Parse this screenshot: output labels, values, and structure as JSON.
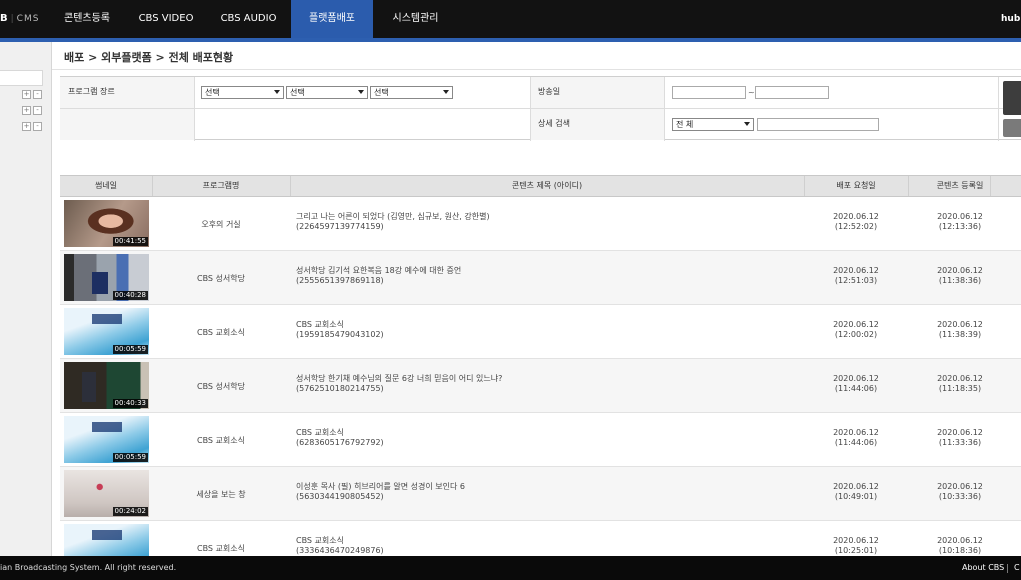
{
  "app": {
    "logo_letter": "B",
    "logo_text": "CMS",
    "user": "hubm"
  },
  "nav": [
    {
      "label": "콘텐츠등록"
    },
    {
      "label": "CBS VIDEO"
    },
    {
      "label": "CBS AUDIO"
    },
    {
      "label": "플랫폼배포"
    },
    {
      "label": "시스템관리"
    }
  ],
  "nav_active": "플랫폼배포",
  "breadcrumb": "배포 > 외부플랫폼 > 전체 배포현황",
  "search": {
    "genre_label": "프로그램 장르",
    "genre_selects": [
      "선택",
      "선택",
      "선택"
    ],
    "airdate_label": "방송일",
    "airdate_sep": "~",
    "detail_label": "상세 검색",
    "detail_select": "전 체"
  },
  "table": {
    "headers": [
      "썸네일",
      "프로그램명",
      "콘텐츠 제목 (아이디)",
      "배포 요청일",
      "콘텐츠 등록일"
    ],
    "rows": [
      {
        "thumb": "portrait",
        "duration": "00:41:55",
        "program": "오후의 거실",
        "title": "그리고 나는 어른이 되었다 (김영만, 심규보, 원산, 강한별)",
        "id": "(2264597139774159)",
        "req_date": "2020.06.12",
        "req_time": "(12:52:02)",
        "reg_date": "2020.06.12",
        "reg_time": "(12:13:36)"
      },
      {
        "thumb": "podium",
        "duration": "00:40:28",
        "program": "CBS 성서학당",
        "title": "성서학당 김기석 요한복음 18강 예수에 대한 증언",
        "id": "(2555651397869118)",
        "req_date": "2020.06.12",
        "req_time": "(12:51:03)",
        "reg_date": "2020.06.12",
        "reg_time": "(11:38:36)"
      },
      {
        "thumb": "news",
        "duration": "00:05:59",
        "program": "CBS 교회소식",
        "title": "CBS 교회소식",
        "id": "(1959185479043102)",
        "req_date": "2020.06.12",
        "req_time": "(12:00:02)",
        "reg_date": "2020.06.12",
        "reg_time": "(11:38:39)"
      },
      {
        "thumb": "board",
        "duration": "00:40:33",
        "program": "CBS 성서학당",
        "title": "성서학당 한기채 예수님의 질문 6강 너희 믿음이 어디 있느냐?",
        "id": "(5762510180214755)",
        "req_date": "2020.06.12",
        "req_time": "(11:44:06)",
        "reg_date": "2020.06.12",
        "reg_time": "(11:18:35)"
      },
      {
        "thumb": "news",
        "duration": "00:05:59",
        "program": "CBS 교회소식",
        "title": "CBS 교회소식",
        "id": "(6283605176792792)",
        "req_date": "2020.06.12",
        "req_time": "(11:44:06)",
        "reg_date": "2020.06.12",
        "reg_time": "(11:33:36)"
      },
      {
        "thumb": "room",
        "duration": "00:24:02",
        "program": "세상을 보는 창",
        "title": "이성훈 목사 (필) 히브리어를 알면 성경이 보인다 6",
        "id": "(5630344190805452)",
        "req_date": "2020.06.12",
        "req_time": "(10:49:01)",
        "reg_date": "2020.06.12",
        "reg_time": "(10:33:36)"
      },
      {
        "thumb": "news",
        "duration": "",
        "program": "CBS 교회소식",
        "title": "CBS 교회소식",
        "id": "(3336436470249876)",
        "req_date": "2020.06.12",
        "req_time": "(10:25:01)",
        "reg_date": "2020.06.12",
        "reg_time": "(10:18:36)"
      }
    ]
  },
  "footer": {
    "copyright": "ian Broadcasting System. All right reserved.",
    "about": "About CBS",
    "next": "C"
  }
}
